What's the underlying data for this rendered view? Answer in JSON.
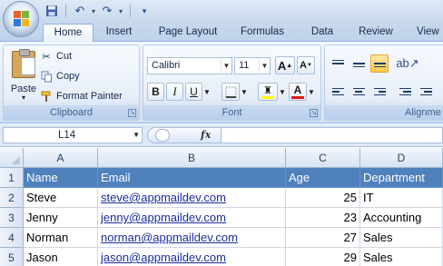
{
  "ribbon": {
    "tabs": [
      "Home",
      "Insert",
      "Page Layout",
      "Formulas",
      "Data",
      "Review",
      "View"
    ],
    "clipboard": {
      "paste_label": "Paste",
      "cut_label": "Cut",
      "copy_label": "Copy",
      "format_painter_label": "Format Painter",
      "group_label": "Clipboard"
    },
    "font": {
      "font_name": "Calibri",
      "font_size": "11",
      "bold": "B",
      "italic": "I",
      "underline": "U",
      "grow": "A",
      "shrink": "A",
      "font_color": "A",
      "group_label": "Font"
    },
    "alignment": {
      "group_label": "Alignme"
    }
  },
  "formula_bar": {
    "name_box": "L14",
    "fx": "fx",
    "formula": ""
  },
  "sheet": {
    "columns": [
      "A",
      "B",
      "C",
      "D"
    ],
    "rows": [
      "1",
      "2",
      "3",
      "4",
      "5"
    ],
    "header": [
      "Name",
      "Email",
      "Age",
      "Department"
    ],
    "data": [
      [
        "Steve",
        "steve@appmaildev.com",
        "25",
        "IT"
      ],
      [
        "Jenny",
        "jenny@appmaildev.com",
        "23",
        "Accounting"
      ],
      [
        "Norman",
        "norman@appmaildev.com",
        "27",
        "Sales"
      ],
      [
        "Jason",
        "jason@appmaildev.com",
        "29",
        "Sales"
      ]
    ]
  },
  "colors": {
    "header_fill": "#4f81bd",
    "link": "#1c2c9e",
    "ribbon": "#dfe8f5",
    "highlight": "#ffc84a",
    "font_color_bar": "#e01b1b",
    "fill_color_bar": "#ffff00"
  }
}
